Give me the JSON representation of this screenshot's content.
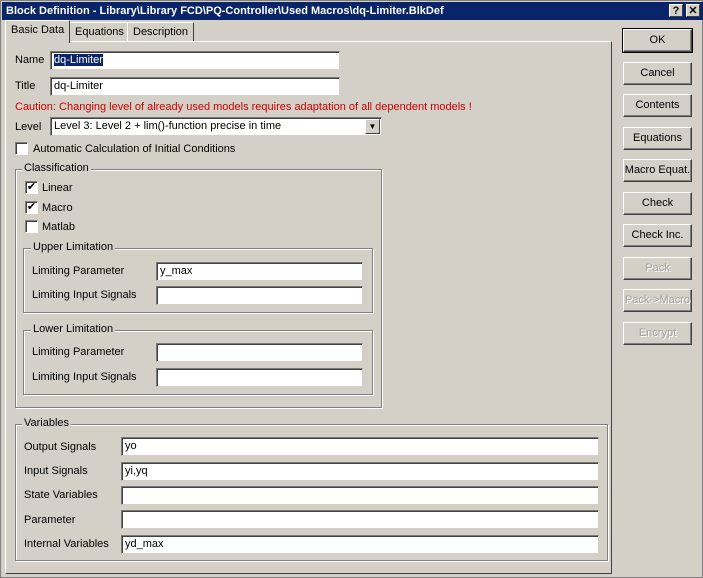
{
  "window": {
    "title": "Block Definition - Library\\Library FCD\\PQ-Controller\\Used Macros\\dq-Limiter.BlkDef",
    "help_label": "?",
    "close_label": "✕"
  },
  "tabs": [
    {
      "label": "Basic Data",
      "active": true
    },
    {
      "label": "Equations",
      "active": false
    },
    {
      "label": "Description",
      "active": false
    }
  ],
  "basic": {
    "name_label": "Name",
    "name_value": "dq-Limiter",
    "title_label": "Title",
    "title_value": "dq-Limiter",
    "caution": "Caution: Changing level of already used models requires adaptation of all dependent models !",
    "level_label": "Level",
    "level_value": "Level 3: Level 2 + lim()-function precise in time",
    "auto_calc_label": "Automatic Calculation of Initial Conditions",
    "auto_calc_checked": false
  },
  "classification": {
    "title": "Classification",
    "linear": {
      "label": "Linear",
      "checked": true
    },
    "macro": {
      "label": "Macro",
      "checked": true
    },
    "matlab": {
      "label": "Matlab",
      "checked": false
    },
    "upper": {
      "title": "Upper Limitation",
      "param_label": "Limiting Parameter",
      "param_value": "y_max",
      "signals_label": "Limiting Input Signals",
      "signals_value": ""
    },
    "lower": {
      "title": "Lower Limitation",
      "param_label": "Limiting Parameter",
      "param_value": "",
      "signals_label": "Limiting Input Signals",
      "signals_value": ""
    }
  },
  "variables": {
    "title": "Variables",
    "output_label": "Output Signals",
    "output_value": "yo",
    "input_label": "Input Signals",
    "input_value": "yi,yq",
    "state_label": "State Variables",
    "state_value": "",
    "param_label": "Parameter",
    "param_value": "",
    "internal_label": "Internal Variables",
    "internal_value": "yd_max"
  },
  "buttons": {
    "ok": "OK",
    "cancel": "Cancel",
    "contents": "Contents",
    "equations": "Equations",
    "macro_equat": "Macro Equat.",
    "check": "Check",
    "check_inc": "Check Inc.",
    "pack": "Pack",
    "pack_macro": "Pack->Macro",
    "encrypt": "Encrypt"
  },
  "colors": {
    "titlebar": "#0a246a",
    "caution": "#cc0000",
    "face": "#d4d0c8"
  }
}
